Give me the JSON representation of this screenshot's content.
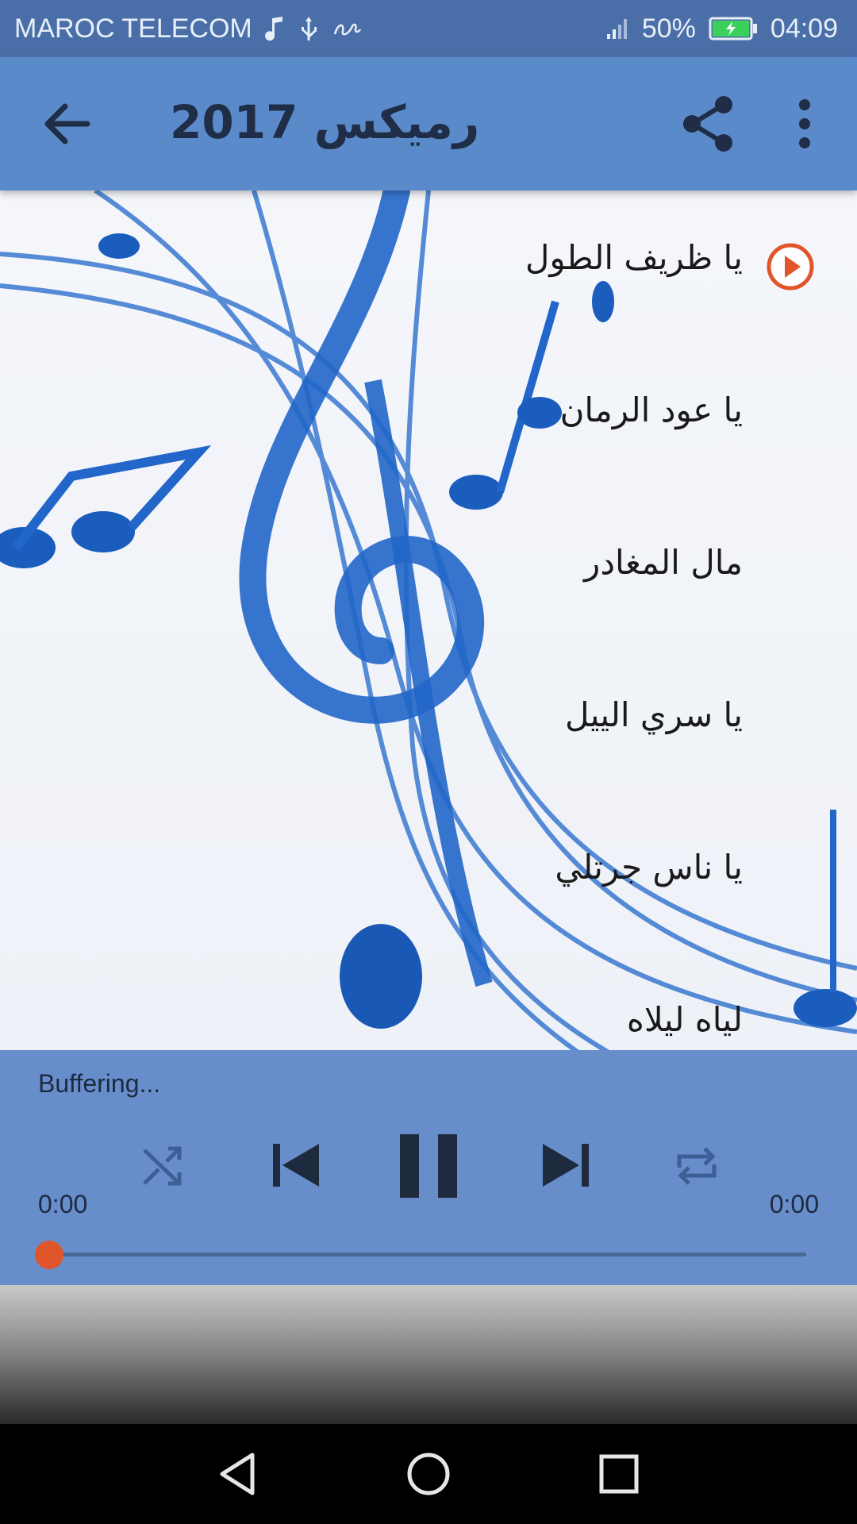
{
  "status_bar": {
    "carrier": "MAROC TELECOM",
    "battery": "50%",
    "time": "04:09"
  },
  "app_bar": {
    "title": "رميكس 2017",
    "back_icon": "arrow-left-icon",
    "share_icon": "share-icon",
    "more_icon": "more-vert-icon"
  },
  "songs": [
    {
      "title": "يا ظريف الطول",
      "playing": true
    },
    {
      "title": "يا عود الرمان",
      "playing": false
    },
    {
      "title": "مال المغادر",
      "playing": false
    },
    {
      "title": "يا سري الييل",
      "playing": false
    },
    {
      "title": "يا ناس جرتلي",
      "playing": false
    },
    {
      "title": "لياه ليلاه",
      "playing": false
    }
  ],
  "player": {
    "status": "Buffering...",
    "elapsed": "0:00",
    "duration": "0:00",
    "progress": 0
  },
  "colors": {
    "status_bar": "#4a6fa8",
    "app_bar": "#5b8acb",
    "accent": "#e0552a",
    "player_panel": "#527ec3"
  }
}
